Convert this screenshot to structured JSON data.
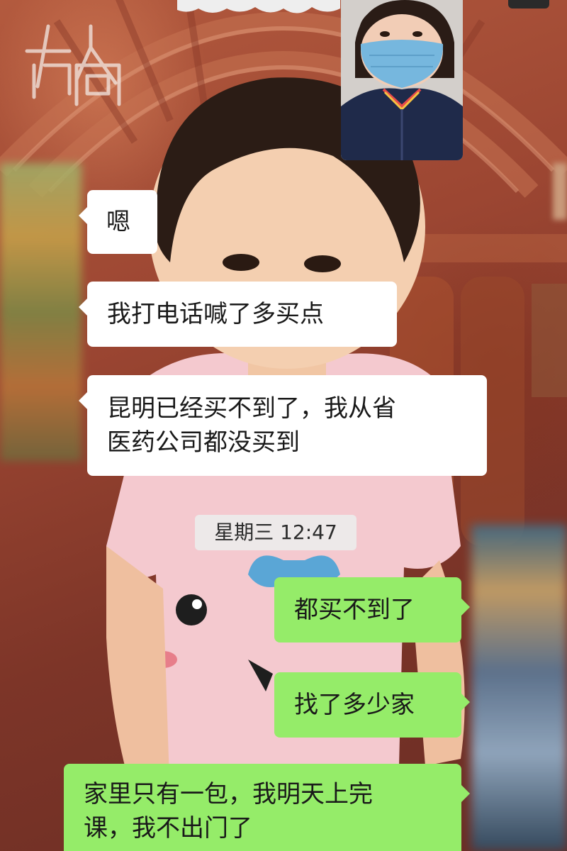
{
  "watermark": {
    "logo_text": "在人間"
  },
  "chat": {
    "messages": [
      {
        "side": "incoming",
        "text": "嗯"
      },
      {
        "side": "incoming",
        "text": "我打电话喊了多买点"
      },
      {
        "side": "incoming",
        "text": "昆明已经买不到了，我从省\n医药公司都没买到"
      },
      {
        "side": "outgoing",
        "text": "都买不到了"
      },
      {
        "side": "outgoing",
        "text": "找了多少家"
      },
      {
        "side": "outgoing",
        "text": "家里只有一包，我明天上完\n课，我不出门了"
      }
    ],
    "timestamp": "星期三 12:47"
  },
  "colors": {
    "incoming_bubble": "#ffffff",
    "outgoing_bubble": "#95ec69",
    "timestamp_bg": "#ebebeb",
    "text": "#191919"
  }
}
